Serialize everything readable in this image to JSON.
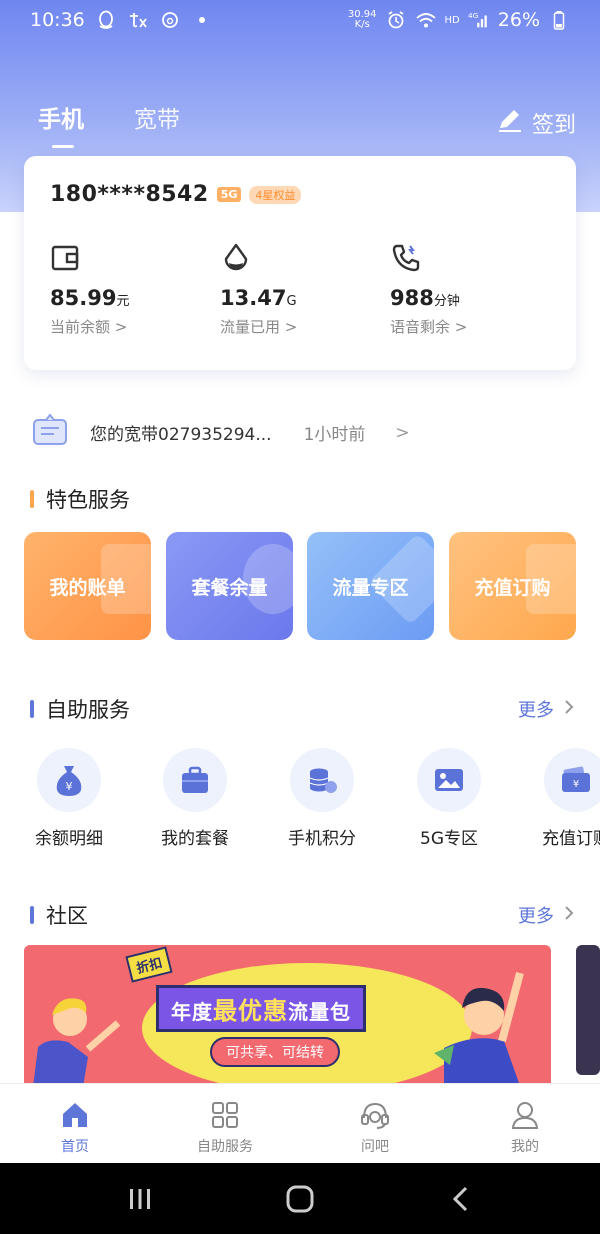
{
  "status_bar": {
    "time": "10:36",
    "speed_value": "30.94",
    "speed_unit": "K/s",
    "network": "HD",
    "signal_type": "4G",
    "battery": "26%"
  },
  "header": {
    "tabs": [
      {
        "label": "手机",
        "active": true
      },
      {
        "label": "宽带",
        "active": false
      }
    ],
    "signin_label": "签到"
  },
  "account": {
    "phone": "180****8542",
    "badge_5g": "5G",
    "badge_star": "4星权益",
    "stats": [
      {
        "value": "85.99",
        "unit": "元",
        "label": "当前余额 >",
        "icon": "wallet-icon"
      },
      {
        "value": "13.47",
        "unit": "G",
        "label": "流量已用 >",
        "icon": "water-drop-icon"
      },
      {
        "value": "988",
        "unit": "分钟",
        "label": "语音剩余 >",
        "icon": "phone-icon"
      }
    ]
  },
  "notice": {
    "text": "您的宽带027935294...",
    "time": "1小时前",
    "chevron": ">"
  },
  "featured": {
    "title": "特色服务",
    "items": [
      {
        "label": "我的账单",
        "color_from": "#ffb36b",
        "color_to": "#ff9346"
      },
      {
        "label": "套餐余量",
        "color_from": "#7f8ff3",
        "color_to": "#6a78ec"
      },
      {
        "label": "流量专区",
        "color_from": "#88b7f7",
        "color_to": "#6c9cf4"
      },
      {
        "label": "充值订购",
        "color_from": "#ffc280",
        "color_to": "#ffa84d"
      }
    ]
  },
  "self_service": {
    "title": "自助服务",
    "more_label": "更多",
    "items": [
      {
        "label": "余额明细",
        "icon": "money-bag-icon"
      },
      {
        "label": "我的套餐",
        "icon": "briefcase-icon"
      },
      {
        "label": "手机积分",
        "icon": "coins-icon"
      },
      {
        "label": "5G专区",
        "icon": "picture-icon"
      },
      {
        "label": "充值订购",
        "icon": "wallet-card-icon"
      }
    ]
  },
  "community": {
    "title": "社区",
    "more_label": "更多",
    "banner": {
      "tag": "折扣",
      "title_pre": "年度",
      "title_highlight": "最优惠",
      "title_post": "流量包",
      "subtitle": "可共享、可结转"
    }
  },
  "bottom_nav": [
    {
      "label": "首页",
      "icon": "home-icon",
      "active": true
    },
    {
      "label": "自助服务",
      "icon": "grid-icon",
      "active": false
    },
    {
      "label": "问吧",
      "icon": "headset-icon",
      "active": false
    },
    {
      "label": "我的",
      "icon": "user-icon",
      "active": false
    }
  ],
  "colors": {
    "accent": "#5e76d8",
    "featured_bar": "#ffa64d",
    "section_bar": "#5e76d8"
  }
}
